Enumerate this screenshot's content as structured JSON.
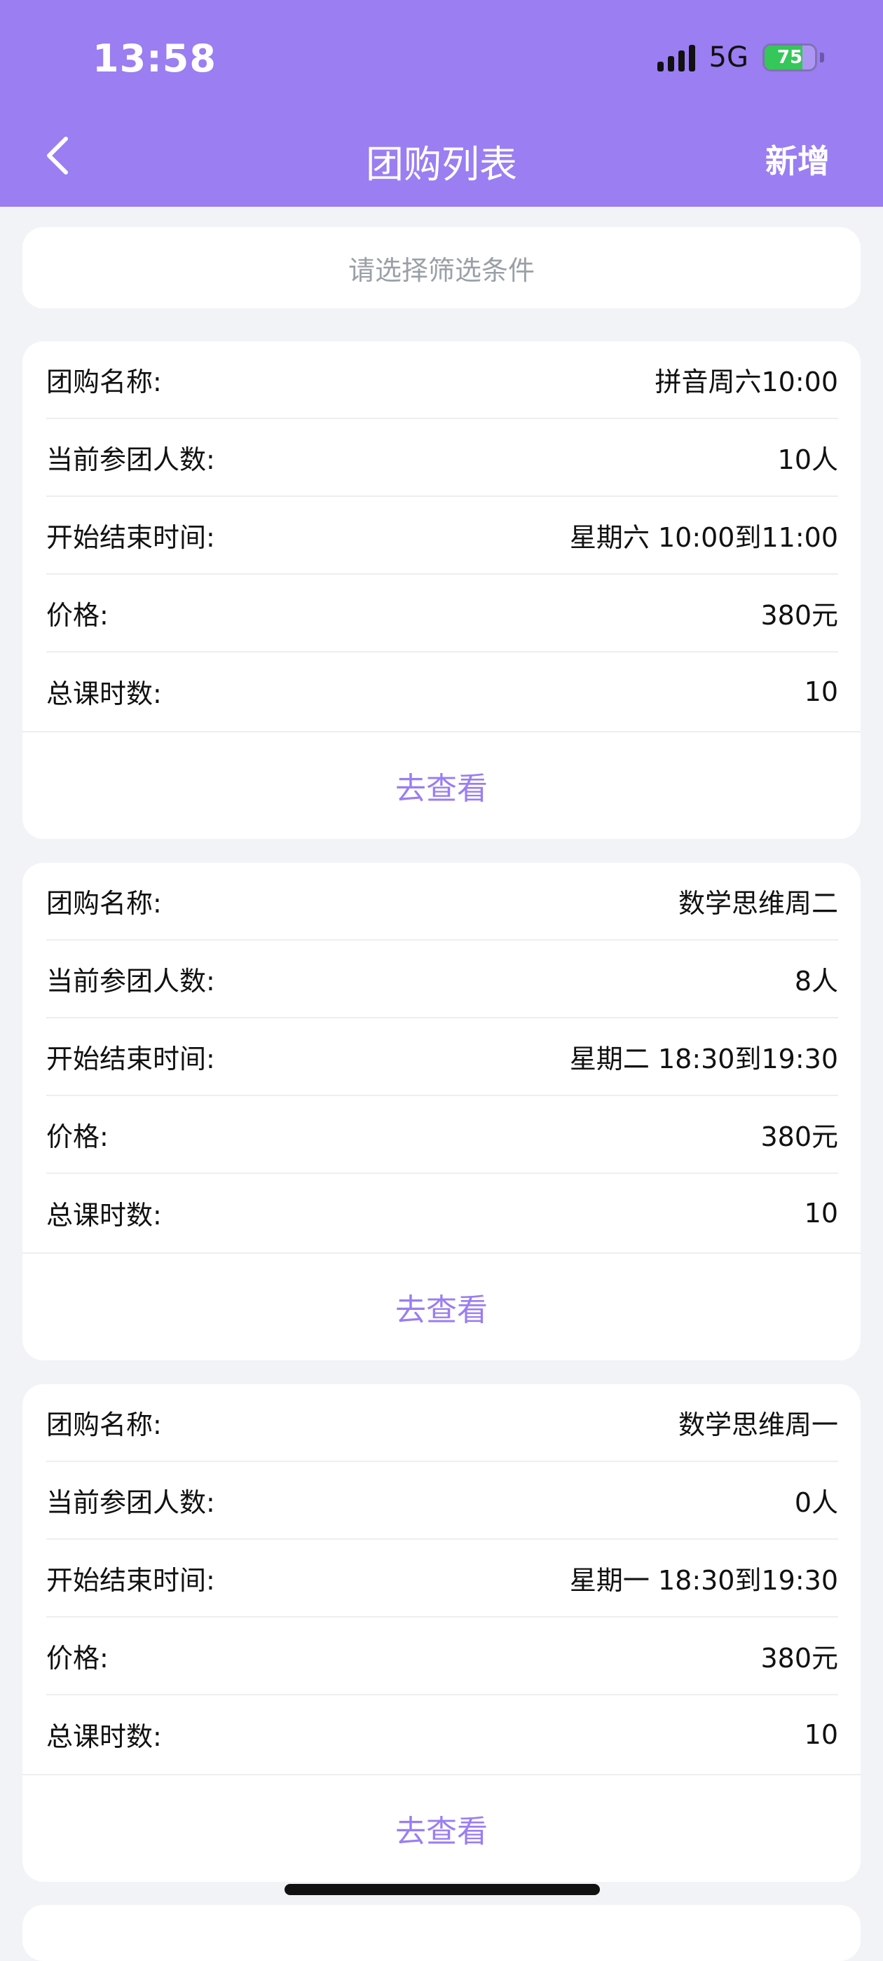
{
  "status_bar": {
    "time": "13:58",
    "network": "5G",
    "battery": "75",
    "battery_level": 0.75
  },
  "nav": {
    "back_icon": "chevron-left-icon",
    "title": "团购列表",
    "action": "新增"
  },
  "filter": {
    "placeholder": "请选择筛选条件"
  },
  "labels": {
    "name": "团购名称:",
    "members": "当前参团人数:",
    "time": "开始结束时间:",
    "price": "价格:",
    "lessons": "总课时数:",
    "view": "去查看"
  },
  "groups": [
    {
      "name": "拼音周六10:00",
      "members": "10人",
      "time": "星期六 10:00到11:00",
      "price": "380元",
      "lessons": "10"
    },
    {
      "name": "数学思维周二",
      "members": "8人",
      "time": "星期二 18:30到19:30",
      "price": "380元",
      "lessons": "10"
    },
    {
      "name": "数学思维周一",
      "members": "0人",
      "time": "星期一 18:30到19:30",
      "price": "380元",
      "lessons": "10"
    }
  ],
  "colors": {
    "brand": "#9a7ef2",
    "background": "#f2f3f6",
    "battery": "#35c759"
  }
}
